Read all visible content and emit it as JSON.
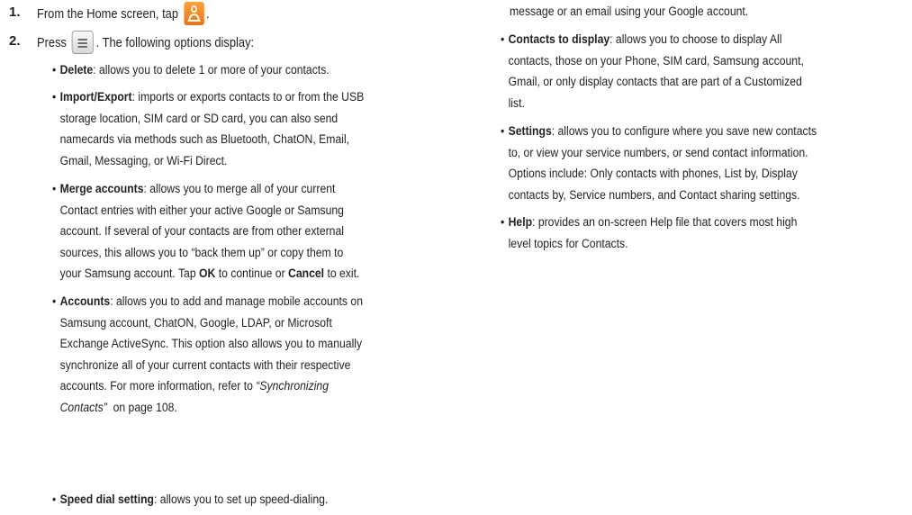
{
  "left": {
    "steps": [
      {
        "num": "1.",
        "before": "From the Home screen, tap",
        "icon": "contacts-app-icon",
        "after": "."
      },
      {
        "num": "2.",
        "before": "Press",
        "icon": "menu-key-icon",
        "after": ". The following options display:"
      }
    ],
    "bullets": [
      {
        "term": "Delete",
        "lines": [
          ": allows you to delete 1 or more of your contacts."
        ]
      },
      {
        "term": "Import/Export",
        "lines": [
          ": imports or exports contacts to or from the USB",
          "storage location, SIM card or SD card, you can also send",
          "namecards via methods such as Bluetooth, ChatON, Email,",
          "Gmail, Messaging, or Wi-Fi Direct."
        ]
      },
      {
        "term": "Merge accounts",
        "lines": [
          ": allows you to merge all of your current",
          "Contact entries with either your active Google or Samsung",
          "account. If several of your contacts are from other external",
          "sources, this allows you to “back them up” or copy them to"
        ],
        "last_line": {
          "a": "your Samsung account. Tap ",
          "b": "OK",
          "c": " to continue or ",
          "d": "Cancel",
          "e": " to exit."
        }
      },
      {
        "term": "Accounts",
        "lines": [
          ": allows you to add and manage mobile accounts on",
          "Samsung account, ChatON, Google, LDAP, or Microsoft",
          "Exchange ActiveSync. This option also allows you to manually",
          "synchronize all of your current contacts with their respective"
        ],
        "ref_line": {
          "a": "accounts. For more information, refer to ",
          "b": "“Synchronizing"
        },
        "ref_line2": {
          "a": "Contacts”",
          "b": "  on page 108."
        }
      },
      {
        "term": "Speed dial setting",
        "lines": [
          ": allows you to set up speed-dialing."
        ]
      }
    ]
  },
  "right": {
    "top_line": "message or an email using your Google account.",
    "bullets": [
      {
        "term": "Contacts to display",
        "lines": [
          ": allows you to choose to display All",
          "contacts, those on your Phone, SIM card, Samsung account,",
          "Gmail, or only display contacts that are part of a Customized",
          "list."
        ]
      },
      {
        "term": "Settings",
        "lines": [
          ": allows you to configure where you save new contacts",
          "to, or view your service numbers, or send contact information.",
          "Options include: Only contacts with phones, List by, Display",
          "contacts by, Service numbers, and Contact sharing settings."
        ]
      },
      {
        "term": "Help",
        "lines": [
          ": provides an on-screen Help file that covers most high",
          "level topics for Contacts."
        ]
      }
    ]
  },
  "colors": {
    "heading_blue": "#1f5fae",
    "text": "#231f20",
    "icon_orange": "#f07212"
  }
}
